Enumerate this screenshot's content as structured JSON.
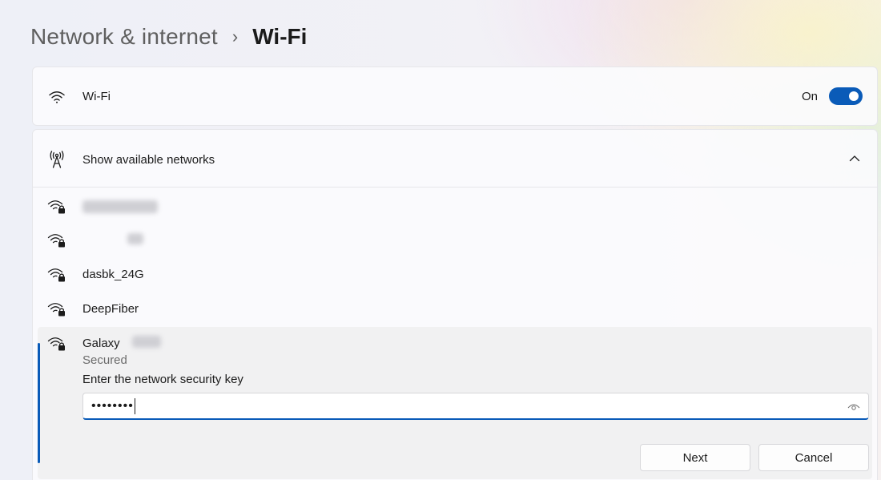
{
  "breadcrumb": {
    "parent": "Network & internet",
    "separator": "›",
    "current": "Wi-Fi"
  },
  "wifi": {
    "label": "Wi-Fi",
    "toggle_text": "On",
    "toggle_on": true,
    "icon": "wifi-icon"
  },
  "networks": {
    "header_label": "Show available networks",
    "header_icon": "antenna-icon",
    "expanded": true,
    "items": [
      {
        "name": "",
        "redacted": true,
        "icon": "wifi-secured-icon"
      },
      {
        "name": "",
        "redacted": true,
        "icon": "wifi-secured-icon"
      },
      {
        "name": "dasbk_24G",
        "icon": "wifi-secured-icon"
      },
      {
        "name": "DeepFiber",
        "icon": "wifi-secured-icon"
      }
    ],
    "selected": {
      "name": "Galaxy",
      "status": "Secured",
      "key_label": "Enter the network security key",
      "key_value": "••••••••",
      "next_label": "Next",
      "cancel_label": "Cancel"
    }
  },
  "colors": {
    "accent": "#0a5bb8",
    "card": "#fbfbfd",
    "selected_bg": "#f1f1f2"
  }
}
